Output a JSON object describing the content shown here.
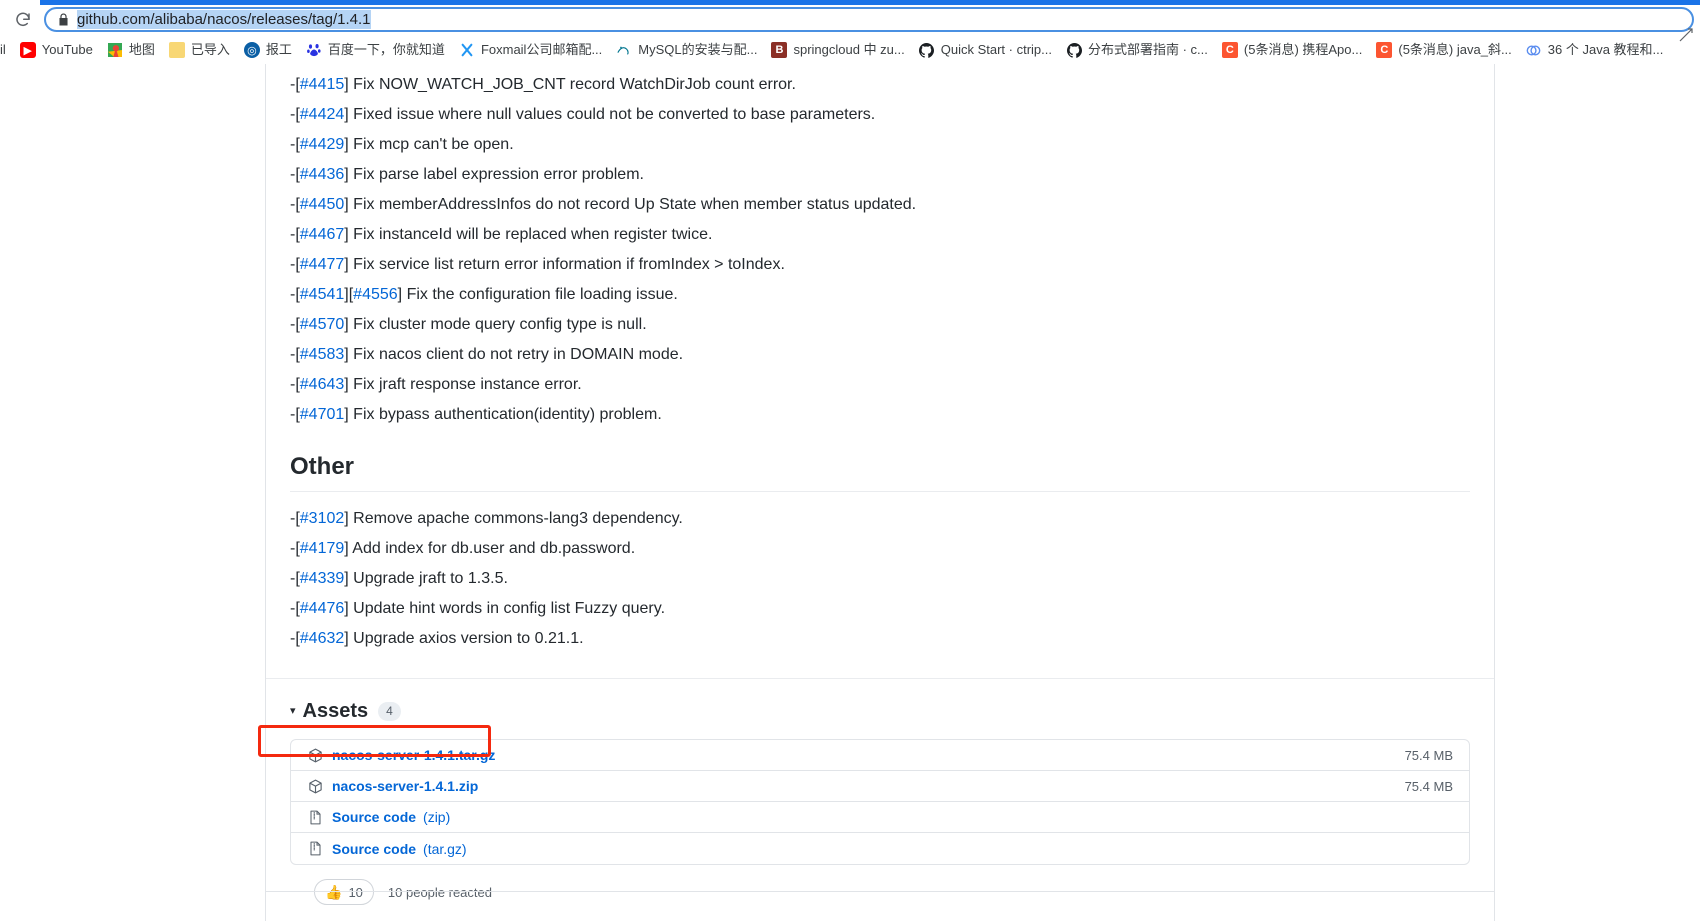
{
  "browser": {
    "reload_icon": "reload-icon",
    "lock_icon": "lock-icon",
    "url": "github.com/alibaba/nacos/releases/tag/1.4.1",
    "restore_icon": "restore-window-icon"
  },
  "bookmarks": [
    {
      "label": "il",
      "icon": "mail-icon"
    },
    {
      "label": "YouTube",
      "icon": "youtube-icon"
    },
    {
      "label": "地图",
      "icon": "google-maps-icon"
    },
    {
      "label": "已导入",
      "icon": "folder-icon"
    },
    {
      "label": "报工",
      "icon": "globe-icon"
    },
    {
      "label": "百度一下，你就知道",
      "icon": "baidu-icon"
    },
    {
      "label": "Foxmail公司邮箱配...",
      "icon": "foxmail-icon"
    },
    {
      "label": "MySQL的安装与配...",
      "icon": "mysql-icon"
    },
    {
      "label": "springcloud 中 zu...",
      "icon": "spring-icon"
    },
    {
      "label": "Quick Start · ctrip...",
      "icon": "github-icon"
    },
    {
      "label": "分布式部署指南 · c...",
      "icon": "github-icon"
    },
    {
      "label": "(5条消息) 携程Apo...",
      "icon": "csdn-icon"
    },
    {
      "label": "(5条消息) java_斜...",
      "icon": "csdn-icon"
    },
    {
      "label": "36 个 Java 教程和...",
      "icon": "java-icon"
    }
  ],
  "release": {
    "bugfix_items": [
      {
        "refs": [
          "#4415"
        ],
        "text": "Fix NOW_WATCH_JOB_CNT record WatchDirJob count error."
      },
      {
        "refs": [
          "#4424"
        ],
        "text": "Fixed issue where null values could not be converted to base parameters."
      },
      {
        "refs": [
          "#4429"
        ],
        "text": "Fix mcp can't be open."
      },
      {
        "refs": [
          "#4436"
        ],
        "text": "Fix parse label expression error problem."
      },
      {
        "refs": [
          "#4450"
        ],
        "text": "Fix memberAddressInfos do not record Up State when member status updated."
      },
      {
        "refs": [
          "#4467"
        ],
        "text": "Fix instanceId will be replaced when register twice."
      },
      {
        "refs": [
          "#4477"
        ],
        "text": "Fix service list return error information if fromIndex > toIndex."
      },
      {
        "refs": [
          "#4541",
          "#4556"
        ],
        "text": "Fix the configuration file loading issue."
      },
      {
        "refs": [
          "#4570"
        ],
        "text": "Fix cluster mode query config type is null."
      },
      {
        "refs": [
          "#4583"
        ],
        "text": "Fix nacos client do not retry in DOMAIN mode."
      },
      {
        "refs": [
          "#4643"
        ],
        "text": "Fix jraft response instance error."
      },
      {
        "refs": [
          "#4701"
        ],
        "text": "Fix bypass authentication(identity) problem."
      }
    ],
    "other_heading": "Other",
    "other_items": [
      {
        "refs": [
          "#3102"
        ],
        "text": "Remove apache commons-lang3 dependency."
      },
      {
        "refs": [
          "#4179"
        ],
        "text": "Add index for db.user and db.password."
      },
      {
        "refs": [
          "#4339"
        ],
        "text": "Upgrade jraft to 1.3.5."
      },
      {
        "refs": [
          "#4476"
        ],
        "text": "Update hint words in config list Fuzzy query."
      },
      {
        "refs": [
          "#4632"
        ],
        "text": "Upgrade axios version to 0.21.1."
      }
    ]
  },
  "assets": {
    "caret": "▾",
    "title": "Assets",
    "count": "4",
    "rows": [
      {
        "icon": "package-icon",
        "name": "nacos-server-1.4.1.tar.gz",
        "ext": "",
        "size": "75.4 MB",
        "highlighted": false
      },
      {
        "icon": "package-icon",
        "name": "nacos-server-1.4.1.zip",
        "ext": "",
        "size": "75.4 MB",
        "highlighted": false
      },
      {
        "icon": "file-zip-icon",
        "name": "Source code",
        "ext": "(zip)",
        "size": "",
        "highlighted": true
      },
      {
        "icon": "file-zip-icon",
        "name": "Source code",
        "ext": "(tar.gz)",
        "size": "",
        "highlighted": false
      }
    ]
  },
  "reactions": {
    "emoji": "👍",
    "count": "10",
    "summary": "10 people reacted"
  },
  "colors": {
    "link": "#0366d6",
    "highlight": "#f4290f",
    "omnibox_border": "#4a90e2",
    "url_selection": "#b5d4f5"
  }
}
